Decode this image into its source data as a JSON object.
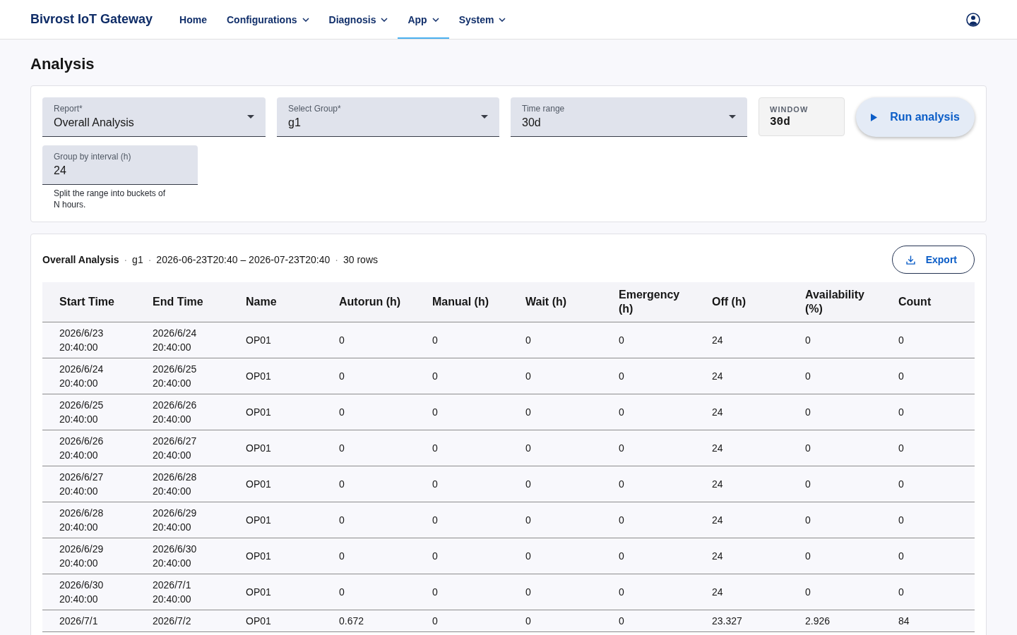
{
  "header": {
    "brand": "Bivrost IoT Gateway",
    "nav": [
      {
        "label": "Home",
        "kind": "link",
        "selected": false
      },
      {
        "label": "Configurations",
        "kind": "menu",
        "selected": false
      },
      {
        "label": "Diagnosis",
        "kind": "menu",
        "selected": false
      },
      {
        "label": "App",
        "kind": "menu",
        "selected": true
      },
      {
        "label": "System",
        "kind": "menu",
        "selected": false
      }
    ]
  },
  "page": {
    "title": "Analysis"
  },
  "form": {
    "fields": [
      {
        "kind": "select",
        "label": "Report*",
        "value": "Overall Analysis"
      },
      {
        "kind": "select",
        "label": "Select Group*",
        "value": "g1"
      },
      {
        "kind": "select",
        "label": "Time range",
        "value": "30d"
      }
    ],
    "window": {
      "label": "WINDOW",
      "value": "30d"
    },
    "run_button": "Run analysis",
    "interval_field": {
      "label": "Group by interval (h)",
      "value": "24",
      "helper": "Split the range into buckets of N hours."
    }
  },
  "results": {
    "summary": [
      {
        "kind": "title",
        "text": "Overall Analysis"
      },
      {
        "kind": "separator",
        "text": "·"
      },
      {
        "kind": "text",
        "text": "g1"
      },
      {
        "kind": "separator",
        "text": "·"
      },
      {
        "kind": "text",
        "text": "2026-06-23T20:40 – 2026-07-23T20:40"
      },
      {
        "kind": "separator",
        "text": "·"
      },
      {
        "kind": "text",
        "text": "30 rows"
      }
    ],
    "export_button": "Export",
    "table": {
      "columns": [
        "Start Time",
        "End Time",
        "Name",
        "Autorun (h)",
        "Manual (h)",
        "Wait (h)",
        "Emergency (h)",
        "Off (h)",
        "Availability (%)",
        "Count"
      ],
      "rows": [
        [
          "2026/6/23 20:40:00",
          "2026/6/24 20:40:00",
          "OP01",
          "0",
          "0",
          "0",
          "0",
          "24",
          "0",
          "0"
        ],
        [
          "2026/6/24 20:40:00",
          "2026/6/25 20:40:00",
          "OP01",
          "0",
          "0",
          "0",
          "0",
          "24",
          "0",
          "0"
        ],
        [
          "2026/6/25 20:40:00",
          "2026/6/26 20:40:00",
          "OP01",
          "0",
          "0",
          "0",
          "0",
          "24",
          "0",
          "0"
        ],
        [
          "2026/6/26 20:40:00",
          "2026/6/27 20:40:00",
          "OP01",
          "0",
          "0",
          "0",
          "0",
          "24",
          "0",
          "0"
        ],
        [
          "2026/6/27 20:40:00",
          "2026/6/28 20:40:00",
          "OP01",
          "0",
          "0",
          "0",
          "0",
          "24",
          "0",
          "0"
        ],
        [
          "2026/6/28 20:40:00",
          "2026/6/29 20:40:00",
          "OP01",
          "0",
          "0",
          "0",
          "0",
          "24",
          "0",
          "0"
        ],
        [
          "2026/6/29 20:40:00",
          "2026/6/30 20:40:00",
          "OP01",
          "0",
          "0",
          "0",
          "0",
          "24",
          "0",
          "0"
        ],
        [
          "2026/6/30 20:40:00",
          "2026/7/1 20:40:00",
          "OP01",
          "0",
          "0",
          "0",
          "0",
          "24",
          "0",
          "0"
        ],
        [
          "2026/7/1",
          "2026/7/2",
          "OP01",
          "0.672",
          "0",
          "0",
          "0",
          "23.327",
          "2.926",
          "84"
        ]
      ]
    }
  }
}
